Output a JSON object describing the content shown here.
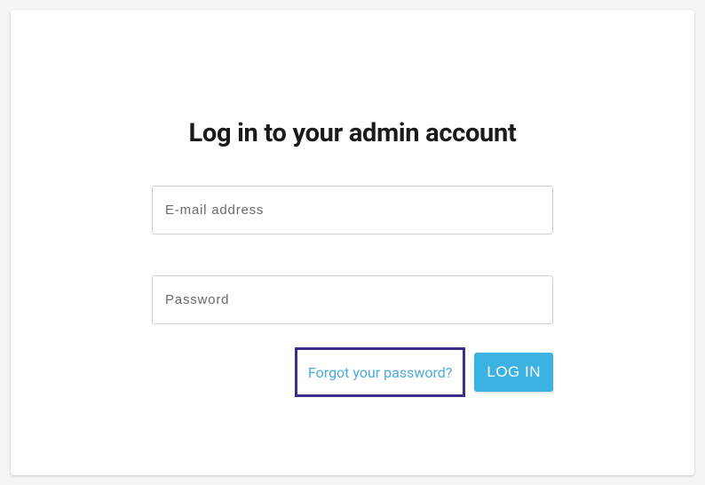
{
  "title": "Log in to your admin account",
  "form": {
    "email_placeholder": "E-mail address",
    "password_placeholder": "Password",
    "forgot_link": "Forgot your password?",
    "login_button": "LOG IN"
  }
}
